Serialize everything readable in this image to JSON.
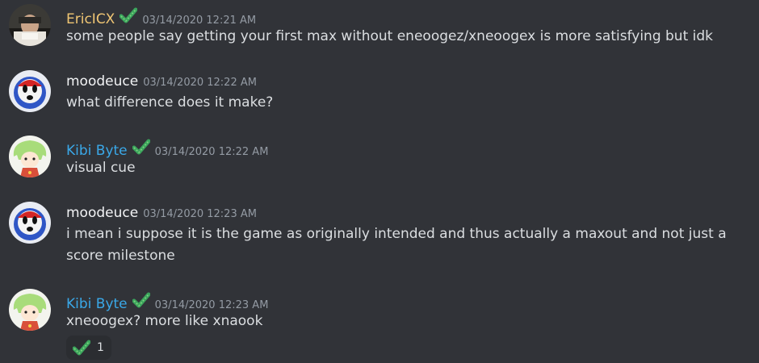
{
  "messages": [
    {
      "username": "EricICX",
      "username_color": "#f0c674",
      "badge_icon": "checkmark-badge-icon",
      "timestamp": "03/14/2020 12:21 AM",
      "text": "some people say getting your first max without eneoogez/xneoogex is more satisfying but idk"
    },
    {
      "username": "moodeuce",
      "username_color": "#f2f3f5",
      "timestamp": "03/14/2020 12:22 AM",
      "text": "what difference does it make?"
    },
    {
      "username": "Kibi Byte",
      "username_color": "#3aa8e8",
      "badge_icon": "checkmark-badge-icon",
      "timestamp": "03/14/2020 12:22 AM",
      "text": "visual cue"
    },
    {
      "username": "moodeuce",
      "username_color": "#f2f3f5",
      "timestamp": "03/14/2020 12:23 AM",
      "text": "i mean i suppose it is the game as originally intended and thus actually a maxout and not just a score milestone"
    },
    {
      "username": "Kibi Byte",
      "username_color": "#3aa8e8",
      "badge_icon": "checkmark-badge-icon",
      "timestamp": "03/14/2020 12:23 AM",
      "text": "xneoogex? more like xnaook",
      "reaction": {
        "icon": "checkmark-reaction-icon",
        "count": "1"
      }
    }
  ]
}
